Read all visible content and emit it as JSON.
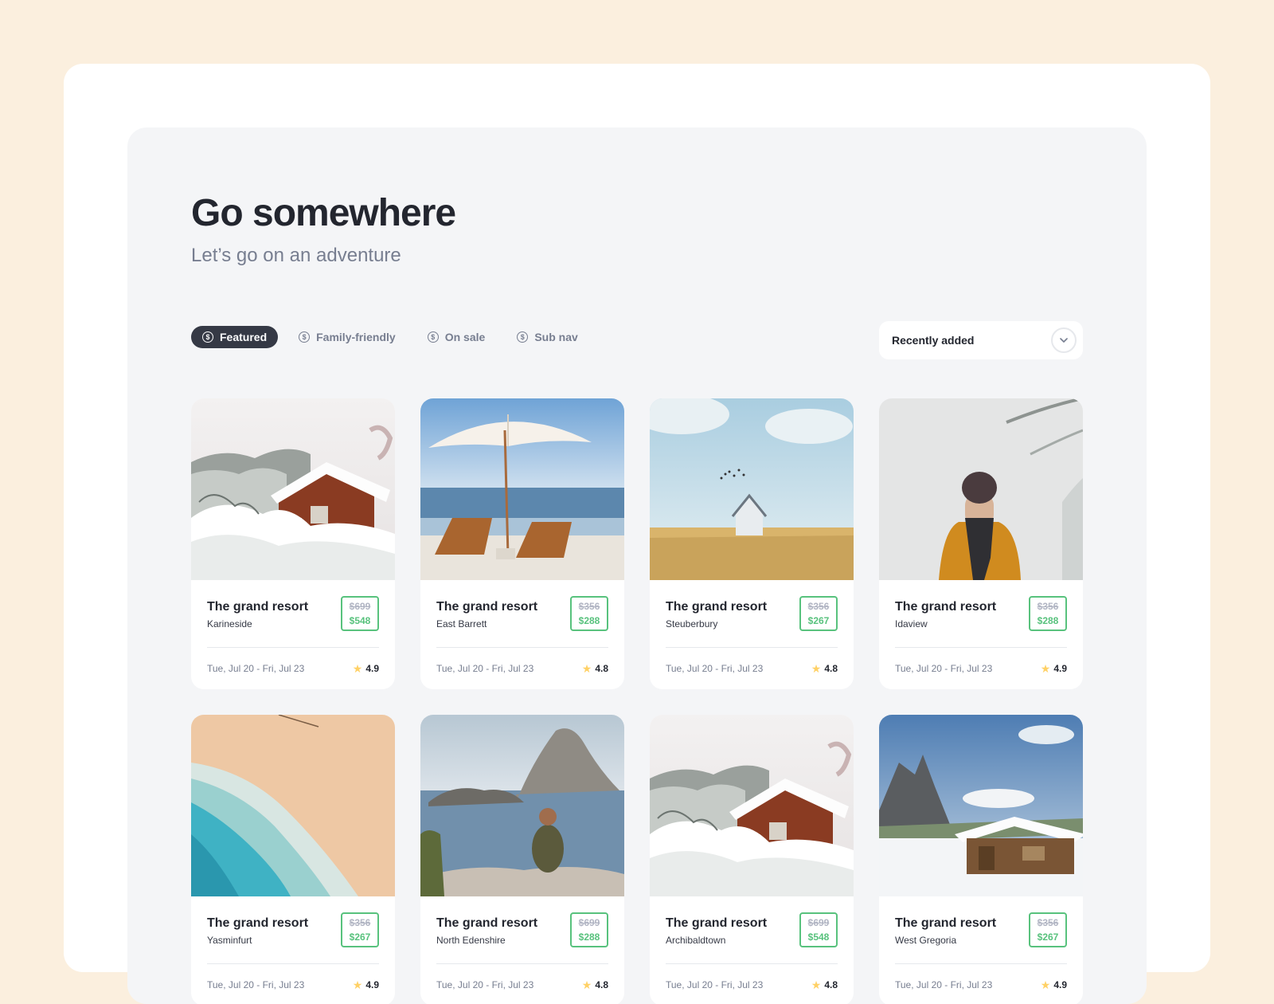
{
  "header": {
    "title": "Go somewhere",
    "subtitle": "Let’s go on an adventure"
  },
  "tabs": [
    {
      "label": "Featured",
      "active": true,
      "icon": "dollar-circle-icon"
    },
    {
      "label": "Family-friendly",
      "active": false,
      "icon": "dollar-circle-icon"
    },
    {
      "label": "On sale",
      "active": false,
      "icon": "dollar-circle-icon"
    },
    {
      "label": "Sub nav",
      "active": false,
      "icon": "dollar-circle-icon"
    }
  ],
  "sort": {
    "value": "Recently added",
    "icon": "chevron-down-icon"
  },
  "cards": [
    {
      "name": "The grand resort",
      "location": "Karineside",
      "old_price": "$699",
      "price": "$548",
      "dates": "Tue, Jul 20 - Fri, Jul 23",
      "rating": "4.9",
      "photo": "snowy-cabin"
    },
    {
      "name": "The grand resort",
      "location": "East Barrett",
      "old_price": "$356",
      "price": "$288",
      "dates": "Tue, Jul 20 - Fri, Jul 23",
      "rating": "4.8",
      "photo": "beach-umbrella"
    },
    {
      "name": "The grand resort",
      "location": "Steuberbury",
      "old_price": "$356",
      "price": "$267",
      "dates": "Tue, Jul 20 - Fri, Jul 23",
      "rating": "4.8",
      "photo": "house-in-field"
    },
    {
      "name": "The grand resort",
      "location": "Idaview",
      "old_price": "$356",
      "price": "$288",
      "dates": "Tue, Jul 20 - Fri, Jul 23",
      "rating": "4.9",
      "photo": "person-in-snow"
    },
    {
      "name": "The grand resort",
      "location": "Yasminfurt",
      "old_price": "$356",
      "price": "$267",
      "dates": "Tue, Jul 20 - Fri, Jul 23",
      "rating": "4.9",
      "photo": "aerial-beach"
    },
    {
      "name": "The grand resort",
      "location": "North Edenshire",
      "old_price": "$699",
      "price": "$288",
      "dates": "Tue, Jul 20 - Fri, Jul 23",
      "rating": "4.8",
      "photo": "rocky-island"
    },
    {
      "name": "The grand resort",
      "location": "Archibaldtown",
      "old_price": "$699",
      "price": "$548",
      "dates": "Tue, Jul 20 - Fri, Jul 23",
      "rating": "4.8",
      "photo": "snowy-cabin"
    },
    {
      "name": "The grand resort",
      "location": "West Gregoria",
      "old_price": "$356",
      "price": "$267",
      "dates": "Tue, Jul 20 - Fri, Jul 23",
      "rating": "4.9",
      "photo": "mountain-cabin"
    }
  ],
  "colors": {
    "page_background": "#fbefde",
    "panel_background": "#f4f5f7",
    "active_tab": "#353945",
    "price_green": "#58c27d",
    "star_yellow": "#ffd166"
  }
}
